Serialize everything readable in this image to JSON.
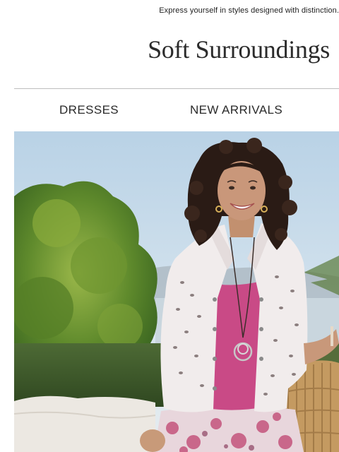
{
  "header": {
    "tagline": "Express yourself in styles designed with distinction.",
    "logo_text": "Soft Surroundings"
  },
  "nav": {
    "items": [
      {
        "label": "DRESSES"
      },
      {
        "label": "NEW ARRIVALS"
      }
    ]
  },
  "hero": {
    "image": "model-in-white-eyelet-jacket-outdoor-photo"
  },
  "colors": {
    "background": "#ffffff",
    "text": "#1a1a1a",
    "divider": "#bdbdbd",
    "sky": "#c9dbe8",
    "top_pink": "#c94a86"
  }
}
